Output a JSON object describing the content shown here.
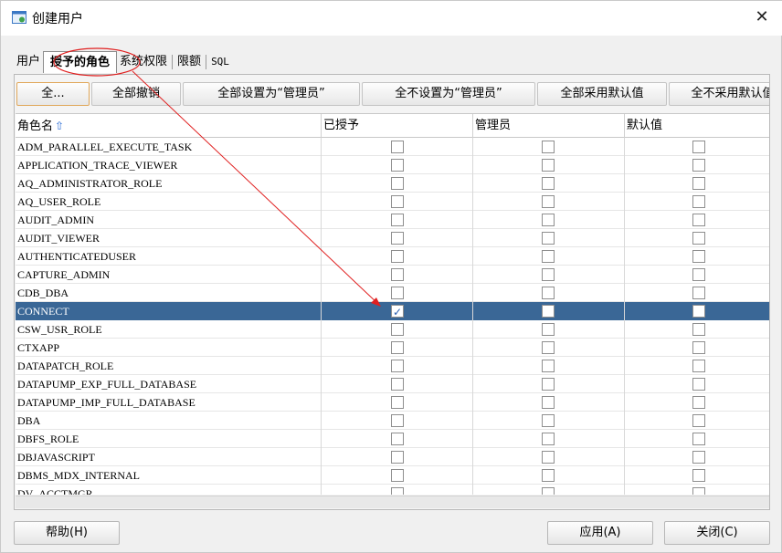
{
  "window": {
    "title": "创建用户",
    "close_label": "✕"
  },
  "tabs": [
    {
      "label": "用户"
    },
    {
      "label": "授予的角色"
    },
    {
      "label": "系统权限"
    },
    {
      "label": "限额"
    },
    {
      "label": "SQL"
    }
  ],
  "toolbar": {
    "buttons": [
      {
        "label": "全..."
      },
      {
        "label": "全部撤销"
      },
      {
        "label": "全部设置为“管理员”"
      },
      {
        "label": "全不设置为“管理员”"
      },
      {
        "label": "全部采用默认值"
      },
      {
        "label": "全不采用默认值"
      }
    ]
  },
  "grid": {
    "columns": [
      {
        "label": "角色名",
        "sort_icon": "⇧"
      },
      {
        "label": "已授予"
      },
      {
        "label": "管理员"
      },
      {
        "label": "默认值"
      }
    ],
    "rows": [
      {
        "name": "ADM_PARALLEL_EXECUTE_TASK",
        "granted": false,
        "admin": false,
        "default": false
      },
      {
        "name": "APPLICATION_TRACE_VIEWER",
        "granted": false,
        "admin": false,
        "default": false
      },
      {
        "name": "AQ_ADMINISTRATOR_ROLE",
        "granted": false,
        "admin": false,
        "default": false
      },
      {
        "name": "AQ_USER_ROLE",
        "granted": false,
        "admin": false,
        "default": false
      },
      {
        "name": "AUDIT_ADMIN",
        "granted": false,
        "admin": false,
        "default": false
      },
      {
        "name": "AUDIT_VIEWER",
        "granted": false,
        "admin": false,
        "default": false
      },
      {
        "name": "AUTHENTICATEDUSER",
        "granted": false,
        "admin": false,
        "default": false
      },
      {
        "name": "CAPTURE_ADMIN",
        "granted": false,
        "admin": false,
        "default": false
      },
      {
        "name": "CDB_DBA",
        "granted": false,
        "admin": false,
        "default": false
      },
      {
        "name": "CONNECT",
        "granted": true,
        "admin": false,
        "default": false,
        "selected": true
      },
      {
        "name": "CSW_USR_ROLE",
        "granted": false,
        "admin": false,
        "default": false
      },
      {
        "name": "CTXAPP",
        "granted": false,
        "admin": false,
        "default": false
      },
      {
        "name": "DATAPATCH_ROLE",
        "granted": false,
        "admin": false,
        "default": false
      },
      {
        "name": "DATAPUMP_EXP_FULL_DATABASE",
        "granted": false,
        "admin": false,
        "default": false
      },
      {
        "name": "DATAPUMP_IMP_FULL_DATABASE",
        "granted": false,
        "admin": false,
        "default": false
      },
      {
        "name": "DBA",
        "granted": false,
        "admin": false,
        "default": false
      },
      {
        "name": "DBFS_ROLE",
        "granted": false,
        "admin": false,
        "default": false
      },
      {
        "name": "DBJAVASCRIPT",
        "granted": false,
        "admin": false,
        "default": false
      },
      {
        "name": "DBMS_MDX_INTERNAL",
        "granted": false,
        "admin": false,
        "default": false
      },
      {
        "name": "DV_ACCTMGR",
        "granted": false,
        "admin": false,
        "default": false
      }
    ]
  },
  "footer": {
    "help_label": "帮助(H)",
    "apply_label": "应用(A)",
    "close_label": "关闭(C)"
  },
  "colors": {
    "selection": "#3a6796",
    "annotation": "#e02020"
  }
}
